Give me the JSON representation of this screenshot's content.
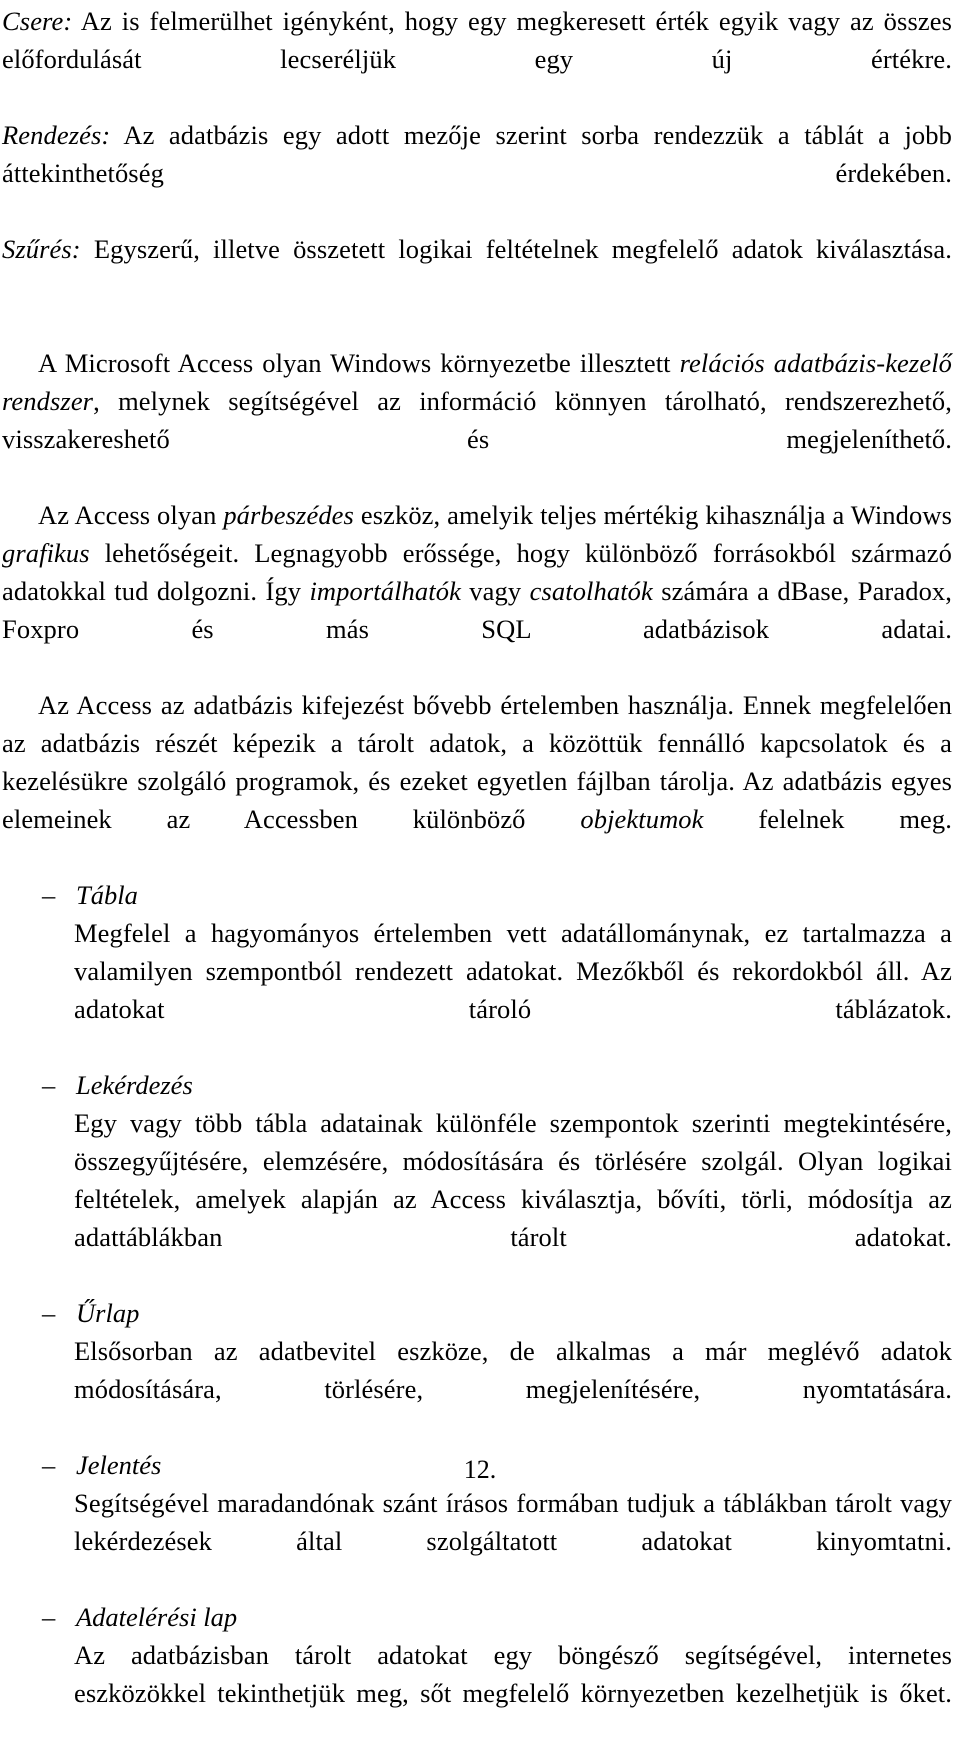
{
  "document": {
    "page_number": "12.",
    "language": "hu"
  },
  "terms": [
    {
      "label": "Csere:",
      "text": " Az is felmerülhet igényként, hogy egy megkeresett érték egyik vagy az összes előfordulását lecseréljük egy új értékre."
    },
    {
      "label": "Rendezés:",
      "text": " Az adatbázis egy adott mezője szerint sorba rendezzük a táblát a jobb áttekinthetőség érdekében."
    },
    {
      "label": "Szűrés:",
      "text": " Egyszerű, illetve összetett logikai feltételnek megfelelő adatok kiválasztása."
    }
  ],
  "paragraphs": {
    "intro_1_a": "A Microsoft Access olyan Windows környezetbe illesztett ",
    "intro_1_em1": "relációs adatbázis-kezelő rendszer",
    "intro_1_b": ", melynek segítségével az információ könnyen tárolható, rendszerezhető, visszakereshető és megjeleníthető.",
    "intro_2_a": "Az Access olyan ",
    "intro_2_em1": "párbeszédes",
    "intro_2_b": " eszköz, amelyik teljes mértékig kihasználja a Windows ",
    "intro_2_em2": "grafikus",
    "intro_2_c": " lehetőségeit. Legnagyobb erőssége, hogy különböző forrásokból származó adatokkal tud dolgozni. Így ",
    "intro_2_em3": "importálhatók",
    "intro_2_d": " vagy ",
    "intro_2_em4": "csatolhatók",
    "intro_2_e": " számára a dBase, Paradox, Foxpro és más SQL adatbázisok adatai.",
    "intro_3_a": "Az Access az adatbázis kifejezést bővebb értelemben használja. Ennek megfelelően az adatbázis részét képezik a tárolt adatok, a közöttük fennálló kapcsolatok és a kezelésükre szolgáló programok, és ezeket egyetlen fájlban tárolja. Az adatbázis egyes elemeinek az Accessben különböző ",
    "intro_3_em1": "objektumok",
    "intro_3_b": " felelnek meg."
  },
  "objects_list": {
    "dash": "–",
    "items": [
      {
        "title": "Tábla",
        "body": "Megfelel a hagyományos értelemben vett adatállománynak, ez tartalmazza a valamilyen szempontból rendezett adatokat. Mezőkből és rekordokból áll. Az adatokat tároló táblázatok."
      },
      {
        "title": "Lekérdezés",
        "body": "Egy vagy több tábla adatainak különféle szempontok szerinti megtekintésére, összegyűjtésére, elemzésére, módosítására és törlésére szolgál. Olyan logikai feltételek, amelyek alapján az Access kiválasztja, bővíti, törli, módosítja az adattáblákban tárolt adatokat."
      },
      {
        "title": "Űrlap",
        "body": "Elsősorban az adatbevitel eszköze, de alkalmas a már meglévő adatok módosítására, törlésére, megjelenítésére, nyomtatására."
      },
      {
        "title": "Jelentés",
        "body": "Segítségével maradandónak szánt írásos formában tudjuk a táblákban tárolt vagy lekérdezések által szolgáltatott adatokat kinyomtatni."
      },
      {
        "title": "Adatelérési lap",
        "body": "Az adatbázisban tárolt adatokat egy böngésző segítségével, internetes eszközökkel tekinthetjük meg, sőt megfelelő környezetben kezelhetjük is őket."
      }
    ]
  }
}
